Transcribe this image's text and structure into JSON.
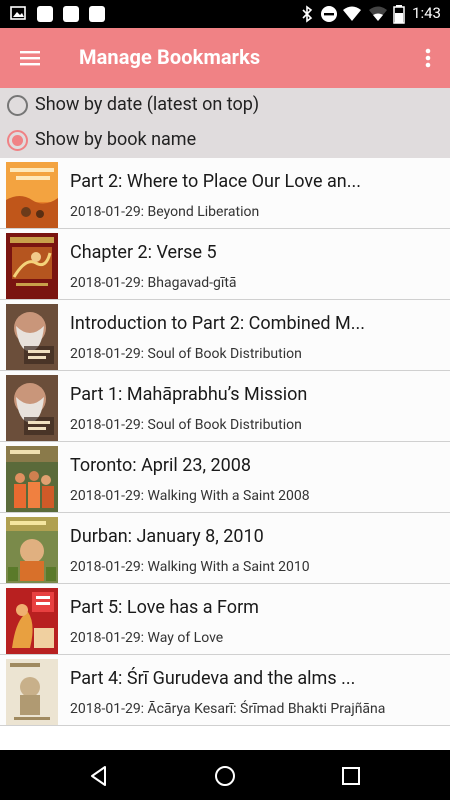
{
  "status_bar": {
    "time": "1:43",
    "left_icons": [
      "image-icon",
      "square-icon",
      "square-icon",
      "square-icon"
    ],
    "right_icons": [
      "bluetooth-icon",
      "do-not-disturb-icon",
      "wifi-icon",
      "battery-icon"
    ]
  },
  "app_bar": {
    "title": "Manage Bookmarks",
    "menu_icon": "menu-icon",
    "overflow_icon": "more-vert-icon",
    "color": "#f08285"
  },
  "sort_options": [
    {
      "label": "Show by date (latest on top)",
      "selected": false
    },
    {
      "label": "Show by book name",
      "selected": true
    }
  ],
  "bookmarks": [
    {
      "title": "Part 2: Where to Place Our Love an...",
      "subtitle": "2018-01-29: Beyond Liberation"
    },
    {
      "title": "Chapter 2: Verse 5",
      "subtitle": "2018-01-29: Bhagavad-gītā"
    },
    {
      "title": "Introduction to Part 2: Combined M...",
      "subtitle": "2018-01-29: Soul of Book Distribution"
    },
    {
      "title": "Part 1: Mahāprabhu’s Mission",
      "subtitle": "2018-01-29: Soul of Book Distribution"
    },
    {
      "title": "Toronto: April 23, 2008",
      "subtitle": "2018-01-29: Walking With a Saint 2008"
    },
    {
      "title": "Durban: January 8, 2010",
      "subtitle": "2018-01-29: Walking With a Saint 2010"
    },
    {
      "title": "Part 5: Love has a Form",
      "subtitle": "2018-01-29: Way of Love"
    },
    {
      "title": "Part 4: Śrī Gurudeva and the alms ...",
      "subtitle": "2018-01-29: Ācārya Kesarī: Śrīmad Bhakti Prajñāna"
    }
  ],
  "nav_bar": {
    "buttons": [
      "back-icon",
      "home-icon",
      "recents-icon"
    ]
  }
}
